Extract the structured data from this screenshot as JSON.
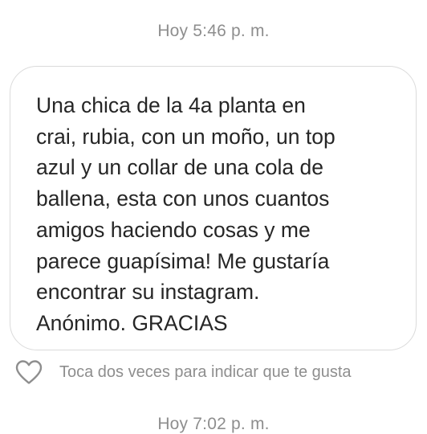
{
  "thread": {
    "messages": [
      {
        "time": "Hoy 5:46 p. m.",
        "text": "Una chica de la 4a planta en\ncrai, rubia, con un moño, un top\nazul y un collar de una cola de\nballena, esta con unos cuantos\namigos haciendo cosas y me\nparece guapísima! Me gustaría\nencontrar su instagram.\nAnónimo. GRACIAS",
        "like_hint": "Toca dos veces para indicar que te gusta",
        "like_icon": "heart-outline-icon"
      },
      {
        "time": "Hoy 7:02 p. m."
      }
    ]
  },
  "colors": {
    "timestamp": "#8e8e8e",
    "message_text": "#262626",
    "bubble_border": "#dbdbdb",
    "background": "#ffffff"
  }
}
